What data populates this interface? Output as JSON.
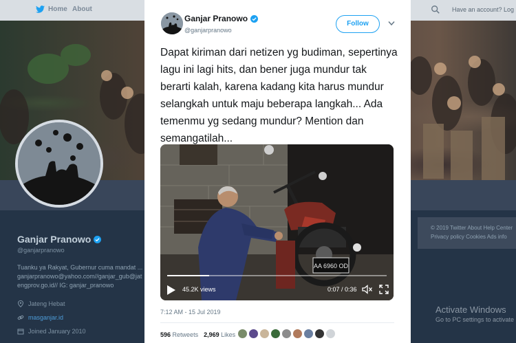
{
  "nav": {
    "home_label": "Home",
    "about_label": "About",
    "account_prompt": "Have an account? Log in ▾"
  },
  "profile": {
    "name": "Ganjar Pranowo",
    "handle": "@ganjarpranowo",
    "bio": "Tuanku ya Rakyat, Gubernur cuma mandat ... ganjarpranowo@yahoo.com//ganjar_gub@jat engprov.go.id// IG: ganjar_pranowo",
    "location": "Jateng Hebat",
    "website": "masganjar.id",
    "joined": "Joined January 2010"
  },
  "sidebar_footer": {
    "line1": "© 2019 Twitter   About   Help Center",
    "line2": "Privacy policy   Cookies   Ads info"
  },
  "watermark": {
    "title": "Activate Windows",
    "subtitle": "Go to PC settings to activate"
  },
  "tweet": {
    "author_name": "Ganjar Pranowo",
    "author_handle": "@ganjarpranowo",
    "follow_label": "Follow",
    "text": "Dapat kiriman dari netizen yg budiman, sepertinya lagu ini lagi hits, dan bener juga mundur tak berarti kalah, karena kadang kita harus mundur selangkah untuk maju beberapa langkah... Ada temenmu yg sedang mundur? Mention dan semangatilah...",
    "video": {
      "views": "45.2K views",
      "time": "0:07 / 0:36",
      "progress": 0.19,
      "plate": "AA 6960 OD"
    },
    "date": "7:12 AM - 15 Jul 2019",
    "retweets_count": "596",
    "retweets_label": "Retweets",
    "likes_count": "2,969",
    "likes_label": "Likes"
  },
  "colors": {
    "accent": "#1da1f2",
    "verified": "#1da1f2",
    "link": "#4d9cd8"
  },
  "likers": [
    "#7a8c6a",
    "#5b4a8c",
    "#c9b59a",
    "#3a6b3a",
    "#8c8c8c",
    "#b07a5c",
    "#6a7fa0",
    "#333333",
    "#d0d4d8"
  ]
}
